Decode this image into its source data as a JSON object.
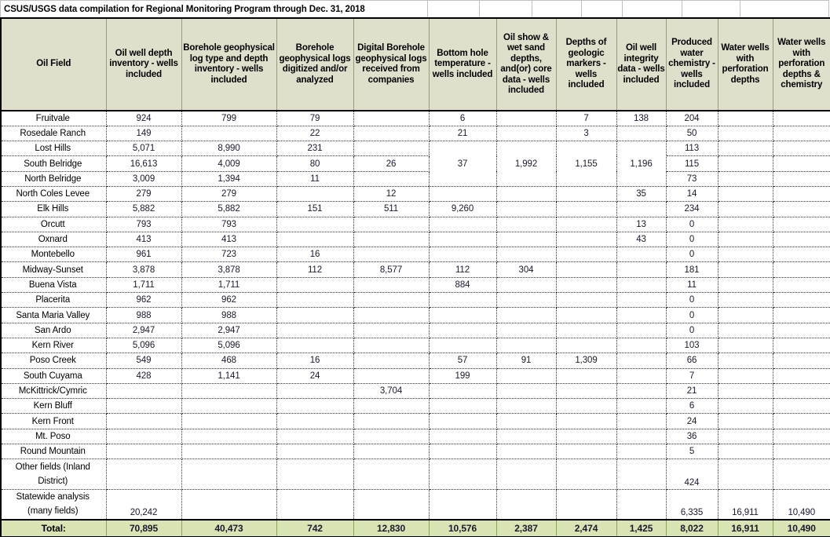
{
  "title": "CSUS/USGS data compilation for Regional Monitoring Program through Dec. 31, 2018",
  "colors": {
    "header_fill": "#DFDFCB",
    "total_fill": "#D8E4B4",
    "grid_border": "#000000",
    "text": "#1A1A2E"
  },
  "columns": [
    "Oil Field",
    "Oil well depth inventory - wells included",
    "Borehole geophysical log type and depth inventory - wells included",
    "Borehole geophysical logs digitized and/or analyzed",
    "Digital Borehole geophysical logs received from companies",
    "Bottom hole temperature - wells included",
    "Oil show & wet sand depths, and(or) core data - wells included",
    "Depths of geologic markers - wells included",
    "Oil well integrity data - wells included",
    "Produced water chemistry - wells included",
    "Water wells with perforation depths",
    "Water wells with perforation depths & chemistry"
  ],
  "rows": [
    {
      "field": "Fruitvale",
      "values": [
        "924",
        "799",
        "79",
        "",
        "6",
        "",
        "7",
        "138",
        "204",
        "",
        ""
      ]
    },
    {
      "field": "Rosedale Ranch",
      "values": [
        "149",
        "",
        "22",
        "",
        "21",
        "",
        "3",
        "",
        "50",
        "",
        ""
      ]
    },
    {
      "field": "Lost Hills",
      "values": [
        "5,071",
        "8,990",
        "231",
        "",
        "",
        "",
        "",
        "",
        "113",
        "",
        ""
      ]
    },
    {
      "field": "South Belridge",
      "values": [
        "16,613",
        "4,009",
        "80",
        "26",
        "37",
        "1,992",
        "1,155",
        "1,196",
        "115",
        "",
        ""
      ]
    },
    {
      "field": "North Belridge",
      "values": [
        "3,009",
        "1,394",
        "11",
        "",
        "",
        "",
        "",
        "",
        "73",
        "",
        ""
      ]
    },
    {
      "field": "North Coles Levee",
      "values": [
        "279",
        "279",
        "",
        "12",
        "",
        "",
        "",
        "35",
        "14",
        "",
        ""
      ]
    },
    {
      "field": "Elk Hills",
      "values": [
        "5,882",
        "5,882",
        "151",
        "511",
        "9,260",
        "",
        "",
        "",
        "234",
        "",
        ""
      ]
    },
    {
      "field": "Orcutt",
      "values": [
        "793",
        "793",
        "",
        "",
        "",
        "",
        "",
        "13",
        "0",
        "",
        ""
      ]
    },
    {
      "field": "Oxnard",
      "values": [
        "413",
        "413",
        "",
        "",
        "",
        "",
        "",
        "43",
        "0",
        "",
        ""
      ]
    },
    {
      "field": "Montebello",
      "values": [
        "961",
        "723",
        "16",
        "",
        "",
        "",
        "",
        "",
        "0",
        "",
        ""
      ]
    },
    {
      "field": "Midway-Sunset",
      "values": [
        "3,878",
        "3,878",
        "112",
        "8,577",
        "112",
        "304",
        "",
        "",
        "181",
        "",
        ""
      ]
    },
    {
      "field": "Buena Vista",
      "values": [
        "1,711",
        "1,711",
        "",
        "",
        "884",
        "",
        "",
        "",
        "11",
        "",
        ""
      ]
    },
    {
      "field": "Placerita",
      "values": [
        "962",
        "962",
        "",
        "",
        "",
        "",
        "",
        "",
        "0",
        "",
        ""
      ]
    },
    {
      "field": "Santa Maria Valley",
      "values": [
        "988",
        "988",
        "",
        "",
        "",
        "",
        "",
        "",
        "0",
        "",
        ""
      ]
    },
    {
      "field": "San Ardo",
      "values": [
        "2,947",
        "2,947",
        "",
        "",
        "",
        "",
        "",
        "",
        "0",
        "",
        ""
      ]
    },
    {
      "field": "Kern River",
      "values": [
        "5,096",
        "5,096",
        "",
        "",
        "",
        "",
        "",
        "",
        "103",
        "",
        ""
      ]
    },
    {
      "field": "Poso Creek",
      "values": [
        "549",
        "468",
        "16",
        "",
        "57",
        "91",
        "1,309",
        "",
        "66",
        "",
        ""
      ]
    },
    {
      "field": "South Cuyama",
      "values": [
        "428",
        "1,141",
        "24",
        "",
        "199",
        "",
        "",
        "",
        "7",
        "",
        ""
      ]
    },
    {
      "field": "McKittrick/Cymric",
      "values": [
        "",
        "",
        "",
        "3,704",
        "",
        "",
        "",
        "",
        "21",
        "",
        ""
      ]
    },
    {
      "field": "Kern Bluff",
      "values": [
        "",
        "",
        "",
        "",
        "",
        "",
        "",
        "",
        "6",
        "",
        ""
      ]
    },
    {
      "field": "Kern Front",
      "values": [
        "",
        "",
        "",
        "",
        "",
        "",
        "",
        "",
        "24",
        "",
        ""
      ]
    },
    {
      "field": "Mt. Poso",
      "values": [
        "",
        "",
        "",
        "",
        "",
        "",
        "",
        "",
        "36",
        "",
        ""
      ]
    },
    {
      "field": "Round Mountain",
      "values": [
        "",
        "",
        "",
        "",
        "",
        "",
        "",
        "",
        "5",
        "",
        ""
      ]
    }
  ],
  "tall_rows": [
    {
      "field_line1": "Other fields (Inland",
      "field_line2": "District)",
      "values": [
        "",
        "",
        "",
        "",
        "",
        "",
        "",
        "",
        "424",
        "",
        ""
      ]
    },
    {
      "field_line1": "Statewide analysis",
      "field_line2": "(many fields)",
      "values": [
        "20,242",
        "",
        "",
        "",
        "",
        "",
        "",
        "",
        "6,335",
        "16,911",
        "10,490"
      ]
    }
  ],
  "totals": {
    "label": "Total:",
    "values": [
      "70,895",
      "40,473",
      "742",
      "12,830",
      "10,576",
      "2,387",
      "2,474",
      "1,425",
      "8,022",
      "16,911",
      "10,490"
    ]
  }
}
